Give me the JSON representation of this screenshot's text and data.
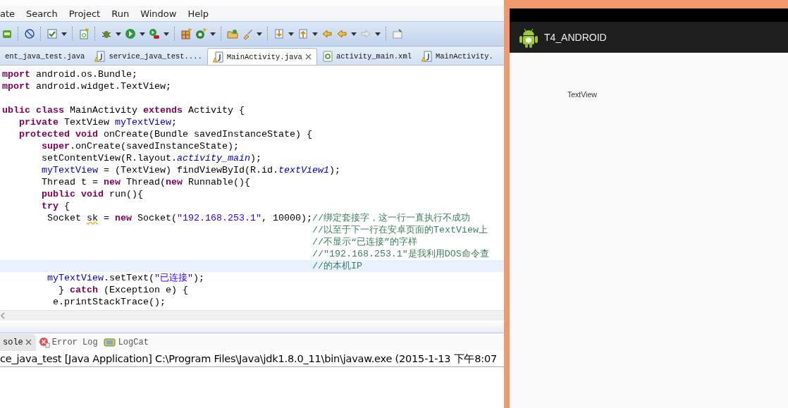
{
  "menu": [
    "ate",
    "Search",
    "Project",
    "Run",
    "Window",
    "Help"
  ],
  "editor_tabs": [
    {
      "label": "ent_java_test.java",
      "kind": "plain",
      "selected": false
    },
    {
      "label": "service_java_test....",
      "kind": "java",
      "selected": false
    },
    {
      "label": "MainActivity.java",
      "kind": "java",
      "selected": true
    },
    {
      "label": "activity_main.xml",
      "kind": "xml",
      "selected": false
    },
    {
      "label": "MainActivity.",
      "kind": "java",
      "selected": false
    }
  ],
  "code_lines": [
    {
      "current": false,
      "segments": [
        {
          "text": "mport",
          "kind": "keyword"
        },
        {
          "text": " android.os.Bundle;",
          "kind": "plain"
        }
      ]
    },
    {
      "current": false,
      "segments": [
        {
          "text": "mport",
          "kind": "keyword"
        },
        {
          "text": " android.widget.TextView;",
          "kind": "plain"
        }
      ]
    },
    {
      "current": false
    },
    {
      "current": false,
      "segments": [
        {
          "text": "ublic class",
          "kind": "keyword"
        },
        {
          "text": " MainActivity ",
          "kind": "plain"
        },
        {
          "text": "extends",
          "kind": "keyword"
        },
        {
          "text": " Activity {",
          "kind": "plain"
        }
      ]
    },
    {
      "current": false,
      "segments": [
        {
          "text": "   private",
          "kind": "keyword"
        },
        {
          "text": " TextView ",
          "kind": "plain"
        },
        {
          "text": "myTextView",
          "kind": "field"
        },
        {
          "text": ";",
          "kind": "plain"
        }
      ]
    },
    {
      "current": false,
      "segments": [
        {
          "text": "   protected void",
          "kind": "keyword"
        },
        {
          "text": " onCreate(Bundle savedInstanceState) {",
          "kind": "plain"
        }
      ]
    },
    {
      "current": false,
      "segments": [
        {
          "text": "       super",
          "kind": "keyword"
        },
        {
          "text": ".onCreate(savedInstanceState);",
          "kind": "plain"
        }
      ]
    },
    {
      "current": false,
      "segments": [
        {
          "text": "       setContentView(R.layout.",
          "kind": "plain"
        },
        {
          "text": "activity_main",
          "kind": "static"
        },
        {
          "text": ");",
          "kind": "plain"
        }
      ]
    },
    {
      "current": false,
      "segments": [
        {
          "text": "       myTextView",
          "kind": "field"
        },
        {
          "text": " = (TextView) findViewById(R.id.",
          "kind": "plain"
        },
        {
          "text": "textView1",
          "kind": "static"
        },
        {
          "text": ");",
          "kind": "plain"
        }
      ]
    },
    {
      "current": false,
      "segments": [
        {
          "text": "       Thread t = ",
          "kind": "plain"
        },
        {
          "text": "new",
          "kind": "keyword"
        },
        {
          "text": " Thread(",
          "kind": "plain"
        },
        {
          "text": "new",
          "kind": "keyword"
        },
        {
          "text": " Runnable(){",
          "kind": "plain"
        }
      ]
    },
    {
      "current": false,
      "segments": [
        {
          "text": "       public void",
          "kind": "keyword"
        },
        {
          "text": " run(){",
          "kind": "plain"
        }
      ]
    },
    {
      "current": false,
      "segments": [
        {
          "text": "       try",
          "kind": "keyword"
        },
        {
          "text": " {",
          "kind": "plain"
        }
      ]
    },
    {
      "current": false,
      "segments": [
        {
          "text": "        Socket ",
          "kind": "plain"
        },
        {
          "text": "sk",
          "kind": "warning"
        },
        {
          "text": " = ",
          "kind": "plain"
        },
        {
          "text": "new",
          "kind": "keyword"
        },
        {
          "text": " Socket(",
          "kind": "plain"
        },
        {
          "text": "\"192.168.253.1\"",
          "kind": "string"
        },
        {
          "text": ", 10000);",
          "kind": "plain"
        },
        {
          "text": "//绑定套接字，这一行一直执行不成功",
          "kind": "comment"
        }
      ]
    },
    {
      "current": false,
      "segments": [
        {
          "text": "                                                       //以至于下一行在安卓页面的TextView上",
          "kind": "comment"
        }
      ]
    },
    {
      "current": false,
      "segments": [
        {
          "text": "                                                       //不显示“已连接”的字样",
          "kind": "comment"
        }
      ]
    },
    {
      "current": false,
      "segments": [
        {
          "text": "                                                       //\"192.168.253.1\"是我利用DOS命令查",
          "kind": "comment"
        }
      ]
    },
    {
      "current": true,
      "segments": [
        {
          "text": "                                                       //的本机IP",
          "kind": "comment"
        }
      ]
    },
    {
      "current": false,
      "segments": [
        {
          "text": "        myTextView",
          "kind": "field"
        },
        {
          "text": ".setText(",
          "kind": "plain"
        },
        {
          "text": "\"已连接\"",
          "kind": "string"
        },
        {
          "text": ");",
          "kind": "plain"
        }
      ]
    },
    {
      "current": false,
      "segments": [
        {
          "text": "          } ",
          "kind": "plain"
        },
        {
          "text": "catch",
          "kind": "keyword"
        },
        {
          "text": " (Exception e) {",
          "kind": "plain"
        }
      ]
    },
    {
      "current": false,
      "segments": [
        {
          "text": "         e.printStackTrace();",
          "kind": "plain"
        }
      ]
    }
  ],
  "console": {
    "tabs": [
      {
        "label": "sole",
        "kind": "plain",
        "selected": true
      },
      {
        "label": "Error Log",
        "kind": "error",
        "selected": false
      },
      {
        "label": "LogCat",
        "kind": "logcat",
        "selected": false
      }
    ],
    "header": "ce_java_test [Java Application] C:\\Program Files\\Java\\jdk1.8.0_11\\bin\\javaw.exe (2015-1-13 下午8:07"
  },
  "emulator": {
    "app_title": "T4_ANDROID",
    "text_view": "TextView"
  }
}
